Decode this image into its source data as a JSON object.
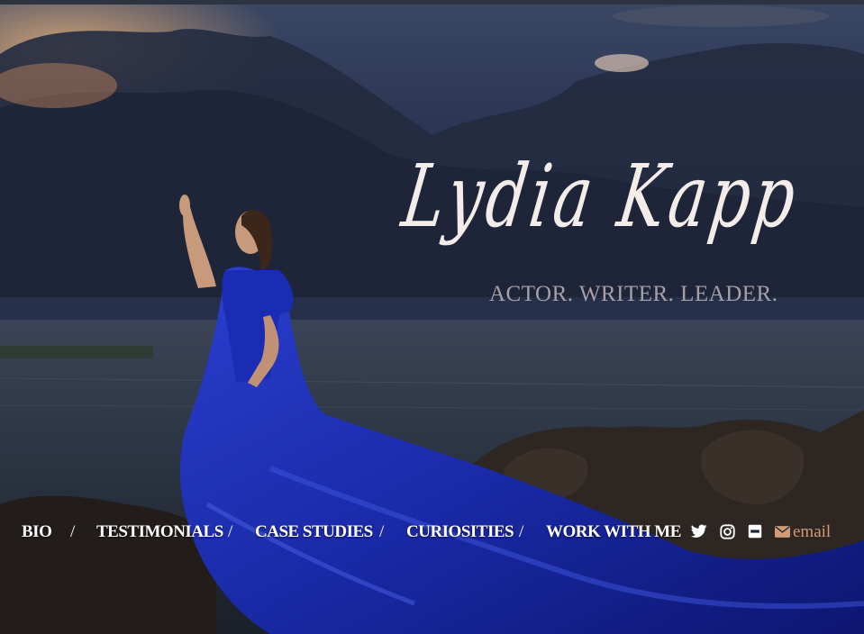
{
  "header": {
    "name": "Lydia Kapp",
    "tagline": "ACTOR. WRITER. LEADER."
  },
  "nav": {
    "items": [
      {
        "label": "BIO"
      },
      {
        "label": "TESTIMONIALS"
      },
      {
        "label": "CASE STUDIES"
      },
      {
        "label": "CURIOSITIES"
      },
      {
        "label": "WORK WITH ME"
      }
    ],
    "separator": "/",
    "social": [
      {
        "icon": "twitter-icon"
      },
      {
        "icon": "instagram-icon"
      },
      {
        "icon": "imdb-icon"
      }
    ],
    "email_label": "email",
    "email_icon": "envelope-icon"
  },
  "colors": {
    "nav_text": "#ffffff",
    "email": "#d29a77",
    "name": "#f3ece9",
    "tagline": "#a7a0a8",
    "gown": "#1d2fb0"
  }
}
